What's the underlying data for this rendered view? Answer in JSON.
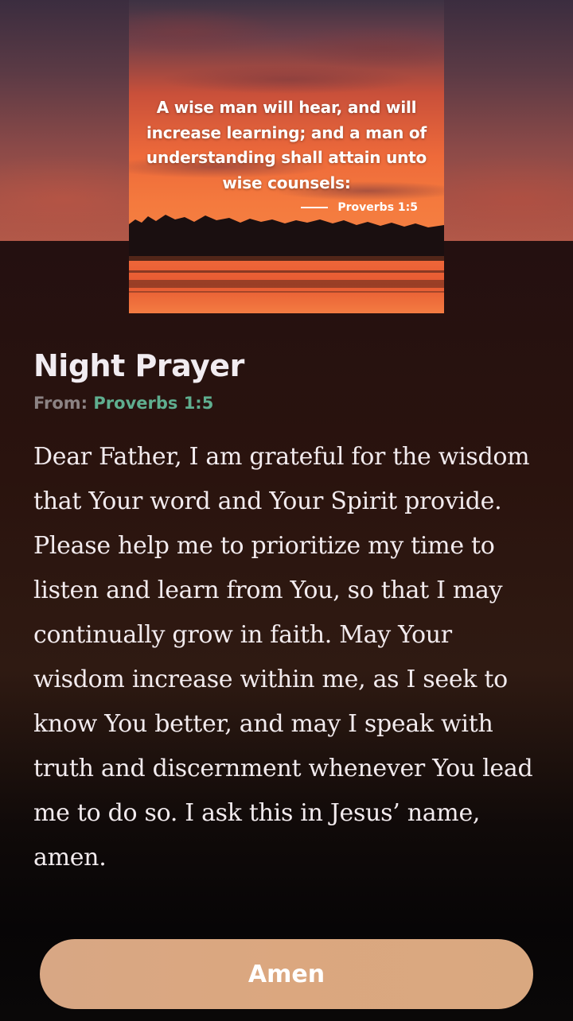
{
  "verse_card": {
    "text": "A wise man will hear, and will increase learning; and a man of understanding shall attain unto wise counsels:",
    "reference": "Proverbs 1:5"
  },
  "prayer": {
    "title": "Night Prayer",
    "from_label": "From:",
    "from_reference": "Proverbs 1:5",
    "body": "Dear Father, I am grateful for the wisdom that Your word and Your Spirit provide. Please help me to prioritize my time to listen and learn from You, so that I may continually grow in faith. May Your wisdom increase within me, as I seek to know You better, and may I speak with truth and discernment whenever You lead me to do so. I ask this in Jesus’ name, amen."
  },
  "actions": {
    "amen_label": "Amen"
  },
  "colors": {
    "accent_green": "#5fae8f",
    "button_tan": "#dba77f",
    "title_text": "#f1ecf1"
  }
}
